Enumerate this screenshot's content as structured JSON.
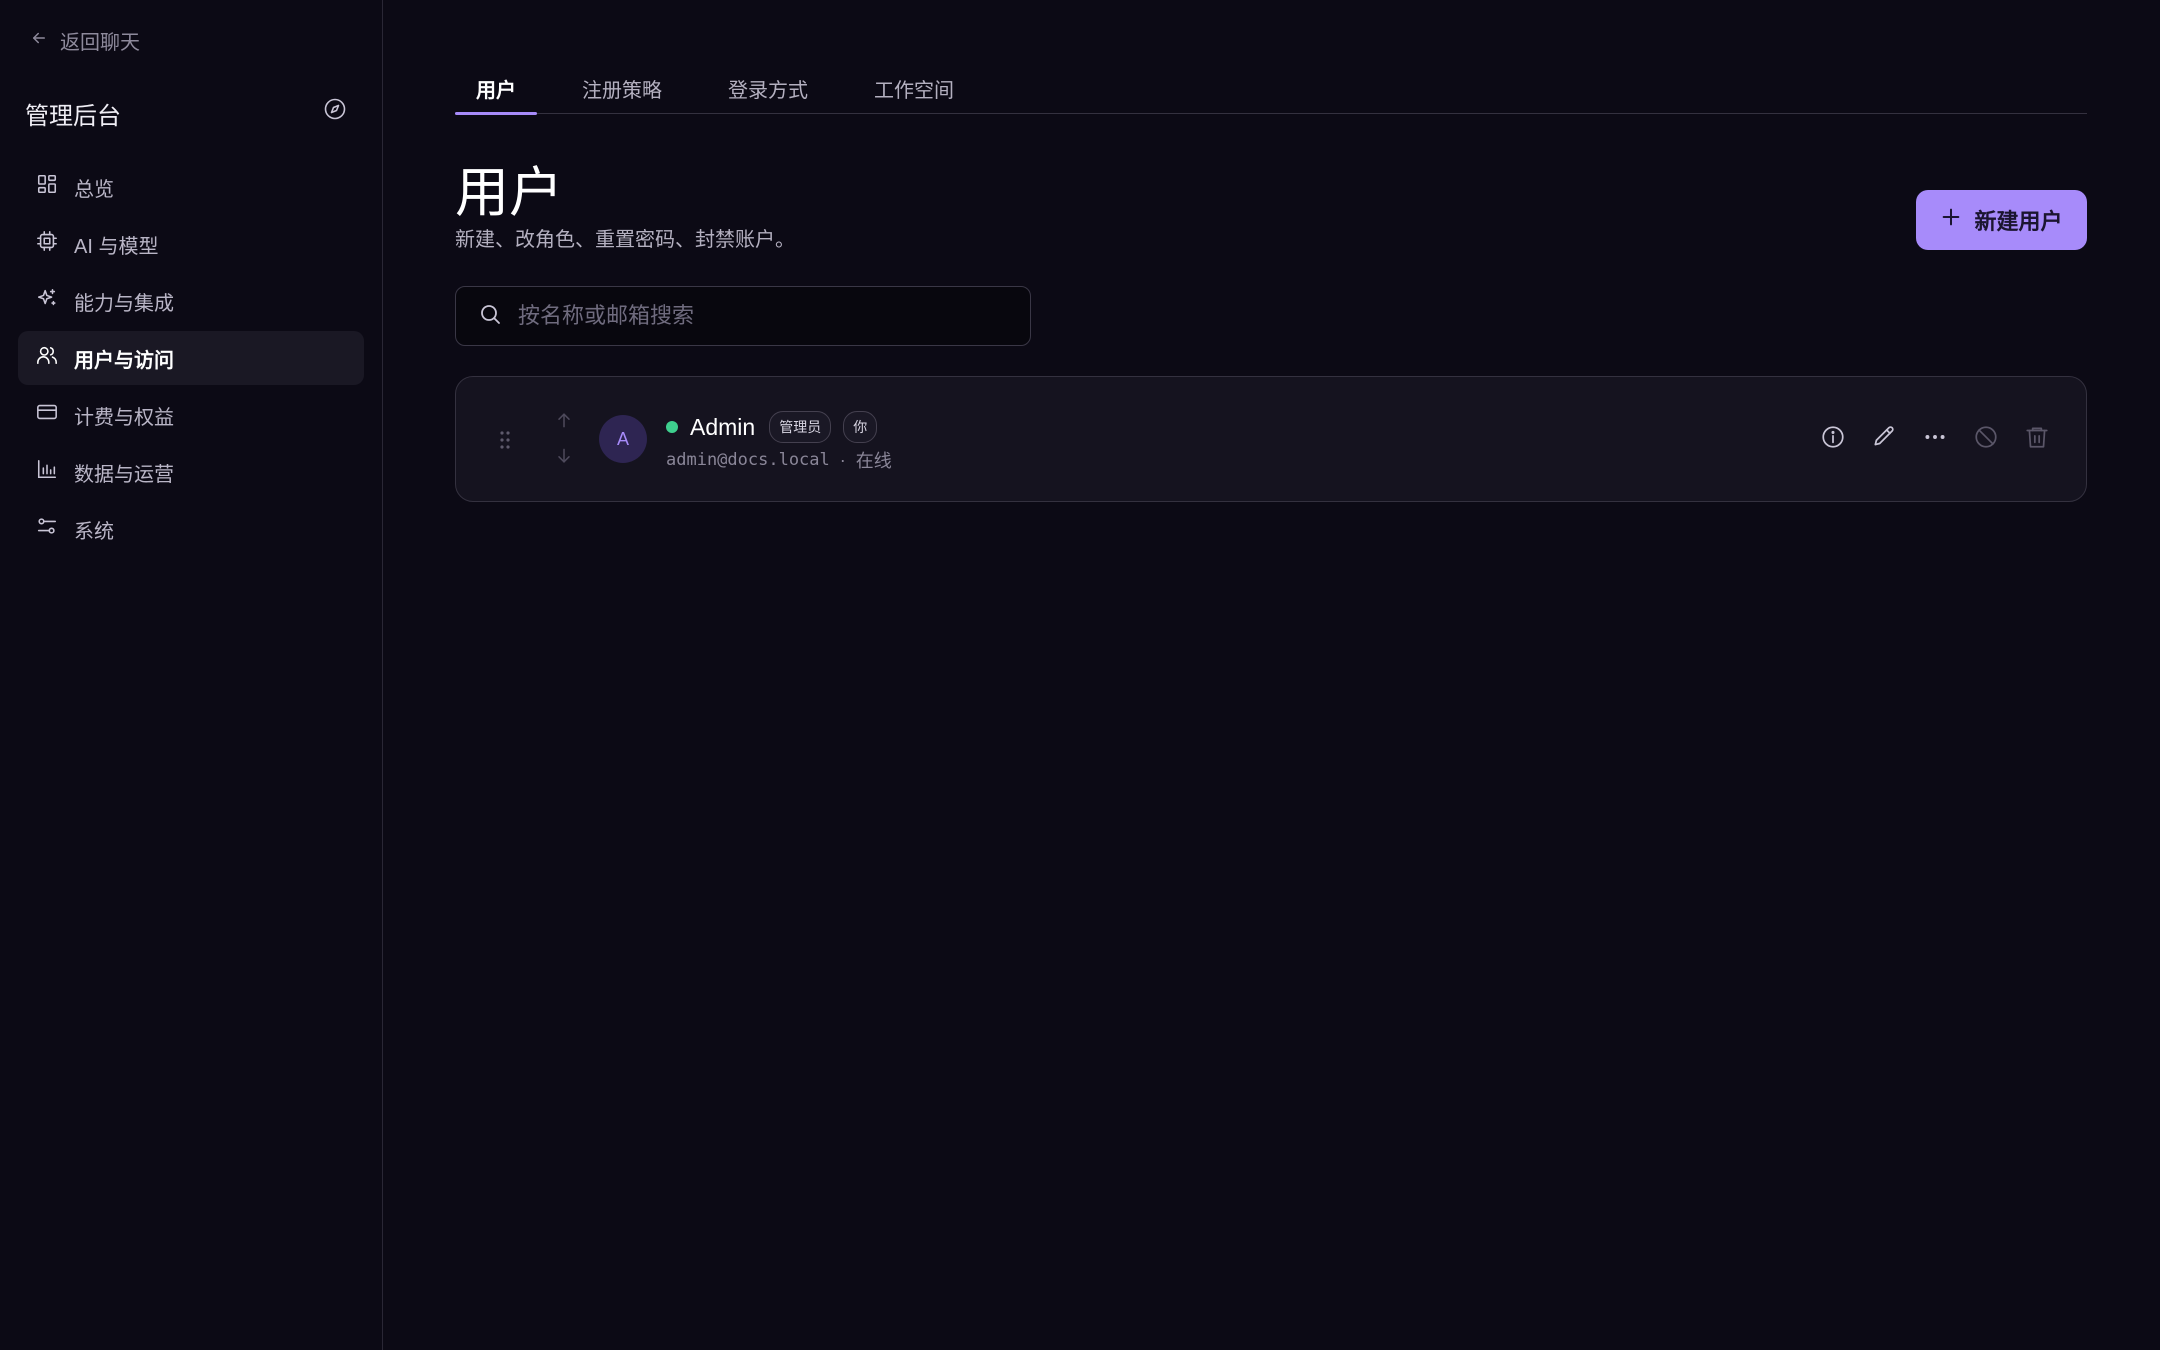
{
  "sidebar": {
    "back_label": "返回聊天",
    "title": "管理后台",
    "items": [
      {
        "label": "总览",
        "icon": "dashboard-icon"
      },
      {
        "label": "AI 与模型",
        "icon": "chip-icon"
      },
      {
        "label": "能力与集成",
        "icon": "sparkles-icon"
      },
      {
        "label": "用户与访问",
        "icon": "users-icon",
        "active": true
      },
      {
        "label": "计费与权益",
        "icon": "credit-card-icon"
      },
      {
        "label": "数据与运营",
        "icon": "bar-chart-icon"
      },
      {
        "label": "系统",
        "icon": "sliders-icon"
      }
    ]
  },
  "tabs": [
    {
      "label": "用户",
      "active": true
    },
    {
      "label": "注册策略"
    },
    {
      "label": "登录方式"
    },
    {
      "label": "工作空间"
    }
  ],
  "page": {
    "title": "用户",
    "subtitle": "新建、改角色、重置密码、封禁账户。",
    "new_user_label": "新建用户"
  },
  "search": {
    "placeholder": "按名称或邮箱搜索",
    "value": ""
  },
  "users": [
    {
      "avatar_letter": "A",
      "name": "Admin",
      "badges": [
        "管理员",
        "你"
      ],
      "email": "admin@docs.local",
      "separator": "·",
      "status": "在线",
      "status_color": "#3ecf8e"
    }
  ],
  "colors": {
    "accent": "#a78bfa",
    "background": "#0c0a15",
    "online": "#3ecf8e"
  }
}
